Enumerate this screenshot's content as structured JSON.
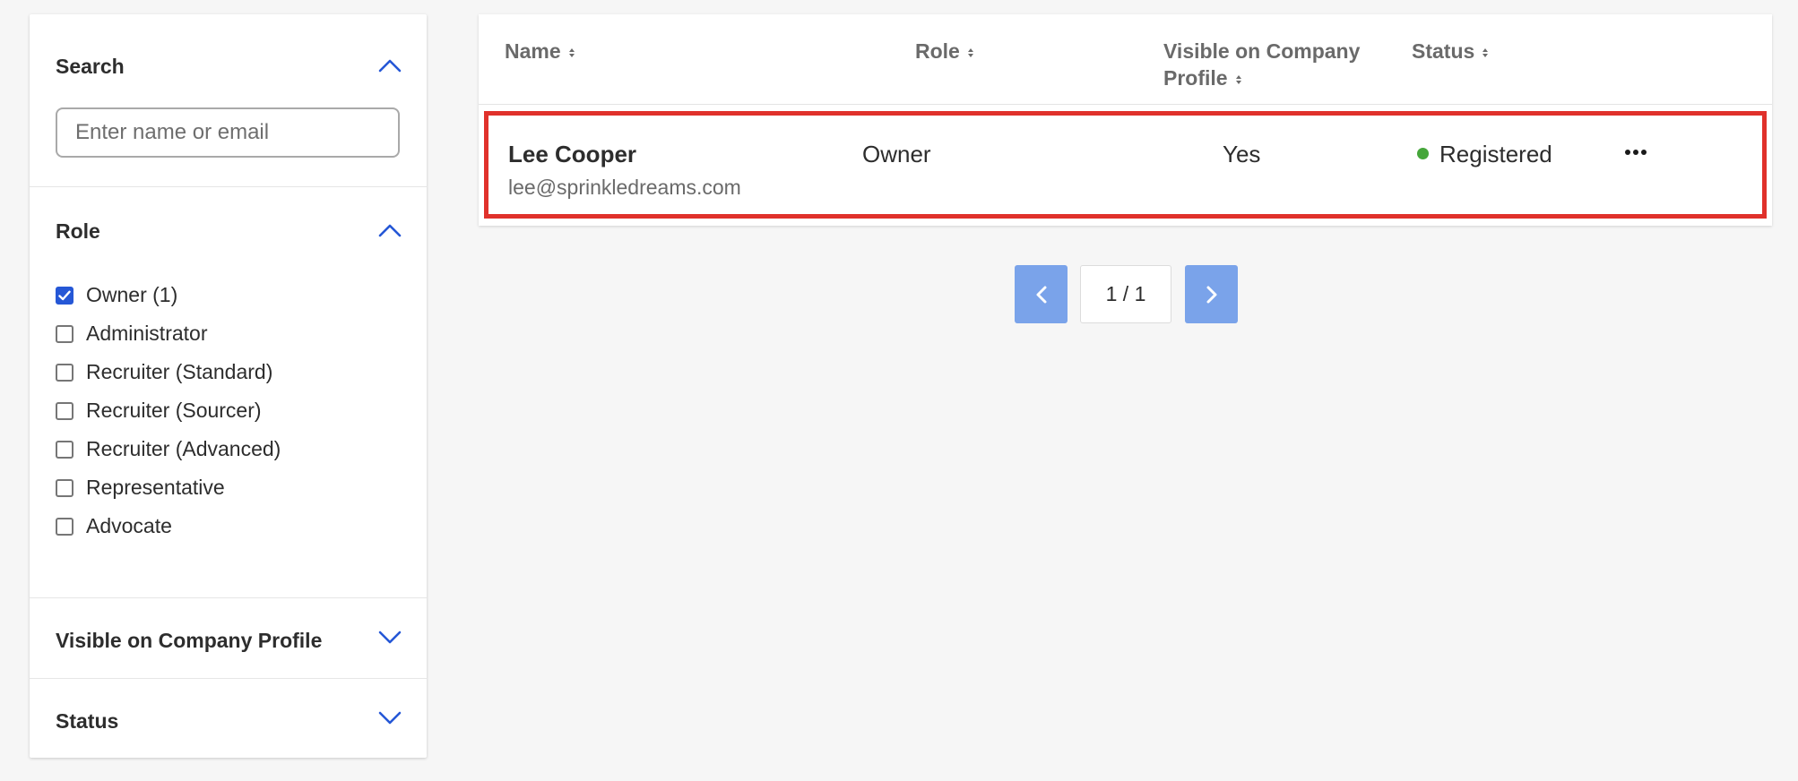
{
  "sidebar": {
    "search": {
      "title": "Search",
      "placeholder": "Enter name or email",
      "value": "",
      "expanded": true
    },
    "role": {
      "title": "Role",
      "expanded": true,
      "options": [
        {
          "label": "Owner (1)",
          "checked": true
        },
        {
          "label": "Administrator",
          "checked": false
        },
        {
          "label": "Recruiter (Standard)",
          "checked": false
        },
        {
          "label": "Recruiter (Sourcer)",
          "checked": false
        },
        {
          "label": "Recruiter (Advanced)",
          "checked": false
        },
        {
          "label": "Representative",
          "checked": false
        },
        {
          "label": "Advocate",
          "checked": false
        }
      ]
    },
    "visible": {
      "title": "Visible on Company Profile",
      "expanded": false
    },
    "status": {
      "title": "Status",
      "expanded": false
    }
  },
  "table": {
    "columns": {
      "name": "Name",
      "role": "Role",
      "visible_line1": "Visible on Company",
      "visible_line2": "Profile",
      "status": "Status"
    },
    "rows": [
      {
        "name": "Lee Cooper",
        "email": "lee@sprinkledreams.com",
        "role": "Owner",
        "visible": "Yes",
        "status": "Registered",
        "status_color": "#45a63a"
      }
    ]
  },
  "pagination": {
    "indicator": "1 / 1"
  },
  "colors": {
    "accent": "#2557d6",
    "highlight": "#e0312b",
    "pagination_button": "#7aa3ea"
  },
  "icons": {
    "expand": "chevron-up-icon",
    "collapse": "chevron-down-icon",
    "sort": "sort-icon",
    "more": "more-horizontal-icon",
    "prev": "chevron-left-icon",
    "next": "chevron-right-icon"
  }
}
